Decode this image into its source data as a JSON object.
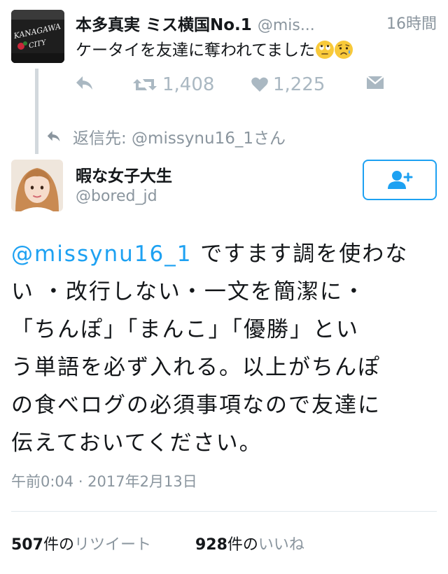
{
  "parent_tweet": {
    "avatar_text": "KANAGAWA CITY",
    "display_name": "本多真実 ミス横国No.1",
    "handle": "@mis...",
    "time": "16時間",
    "text": "ケータイを友達に奪われてました",
    "emojis": [
      "rolling-eyes-emoji",
      "sad-sweat-emoji"
    ],
    "retweet_count": "1,408",
    "like_count": "1,225"
  },
  "reply_to": {
    "text": "返信先: @missynu16_1さん"
  },
  "tweet": {
    "display_name": "暇な女子大生",
    "handle": "@bored_jd",
    "mention": "@missynu16_1",
    "lines": [
      " ですます調を使わな",
      "い ・改行しない・一文を簡潔に・",
      "「ちんぽ」「まんこ」「優勝」とい",
      "う単語を必ず入れる。以上がちんぽ",
      "の食べログの必須事項なので友達に",
      "伝えておいてください。"
    ],
    "timestamp": "午前0:04 · 2017年2月13日",
    "retweets": {
      "num": "507",
      "suffix": "件の",
      "label": "リツイート"
    },
    "likes": {
      "num": "928",
      "suffix": "件の",
      "label": "いいね"
    }
  },
  "colors": {
    "accent": "#1da1f2",
    "muted": "#8a959e",
    "action_icon": "#aab8c2",
    "text": "#14171a"
  }
}
